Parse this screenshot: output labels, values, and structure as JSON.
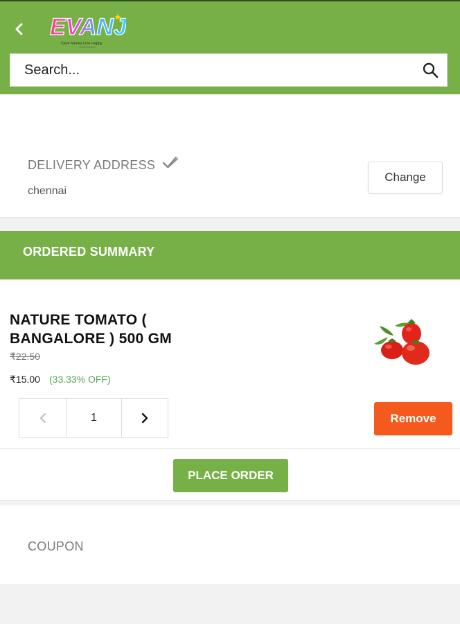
{
  "header": {
    "logo_text": "EVANJ",
    "logo_tagline": "Save Money  Live Happy",
    "back_icon": "chevron-left-icon",
    "search": {
      "placeholder": "Search...",
      "value": "",
      "icon": "search-icon"
    },
    "accent_color": "#76b046"
  },
  "delivery": {
    "title": "DELIVERY ADDRESS",
    "status_icon": "check-icon",
    "address": "chennai",
    "change_label": "Change"
  },
  "summary": {
    "title": "ORDERED SUMMARY"
  },
  "cart": {
    "items": [
      {
        "name": "NATURE TOMATO ( BANGALORE ) 500 GM",
        "original_price": "₹22.50",
        "price": "₹15.00",
        "discount": "(33.33% OFF)",
        "quantity": "1",
        "image_icon": "tomato-icon",
        "remove_label": "Remove",
        "remove_color": "#f4591e"
      }
    ]
  },
  "order": {
    "place_order_label": "PLACE ORDER"
  },
  "coupon": {
    "title": "COUPON"
  }
}
